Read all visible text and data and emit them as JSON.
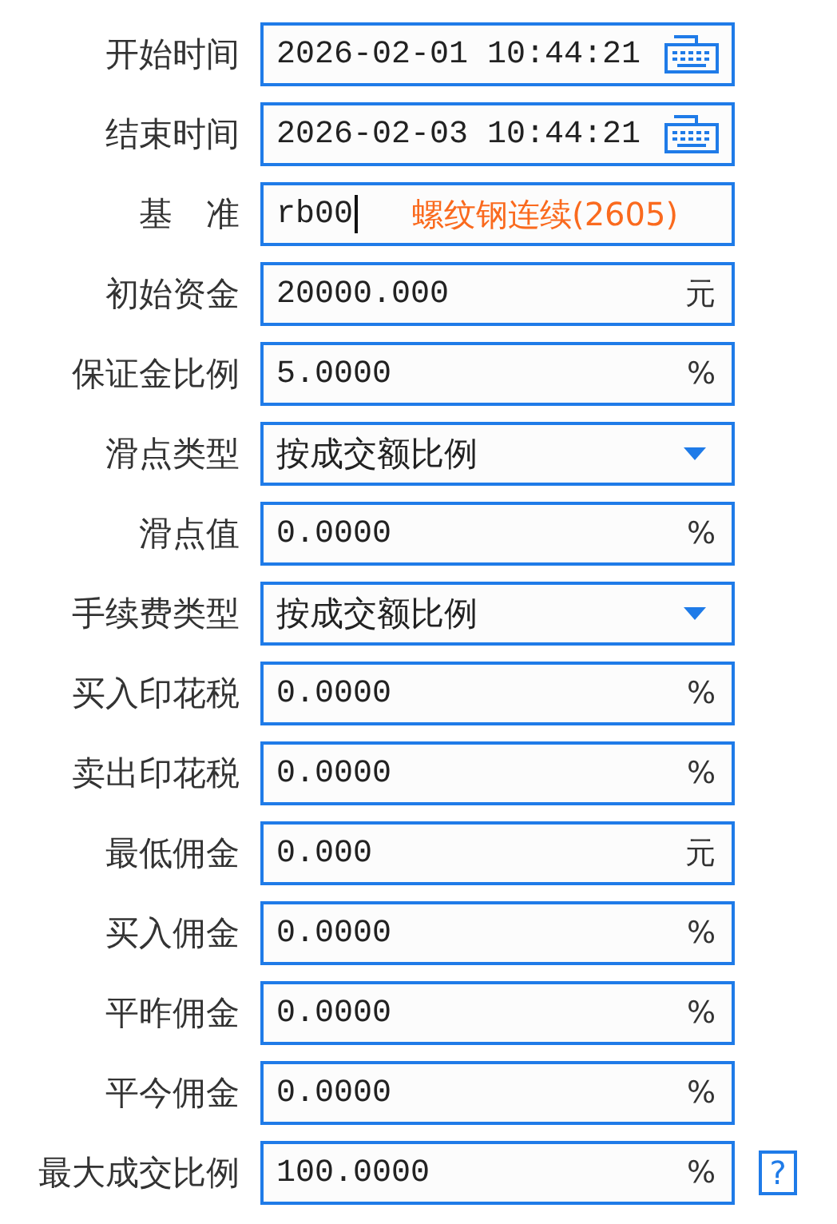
{
  "fields": [
    {
      "kind": "datetime",
      "label": "开始时间",
      "value": "2026-02-01 10:44:21"
    },
    {
      "kind": "datetime",
      "label": "结束时间",
      "value": "2026-02-03 10:44:21"
    },
    {
      "kind": "code",
      "label": "基　准",
      "value": "rb00",
      "focused": true,
      "note": "螺纹钢连续(2605)"
    },
    {
      "kind": "number",
      "label": "初始资金",
      "value": "20000.000",
      "unit": "元"
    },
    {
      "kind": "number",
      "label": "保证金比例",
      "value": "5.0000",
      "unit": "%"
    },
    {
      "kind": "select",
      "label": "滑点类型",
      "value": "按成交额比例"
    },
    {
      "kind": "number",
      "label": "滑点值",
      "value": "0.0000",
      "unit": "%"
    },
    {
      "kind": "select",
      "label": "手续费类型",
      "value": "按成交额比例"
    },
    {
      "kind": "number",
      "label": "买入印花税",
      "value": "0.0000",
      "unit": "%"
    },
    {
      "kind": "number",
      "label": "卖出印花税",
      "value": "0.0000",
      "unit": "%"
    },
    {
      "kind": "number",
      "label": "最低佣金",
      "value": "0.000",
      "unit": "元"
    },
    {
      "kind": "number",
      "label": "买入佣金",
      "value": "0.0000",
      "unit": "%"
    },
    {
      "kind": "number",
      "label": "平昨佣金",
      "value": "0.0000",
      "unit": "%"
    },
    {
      "kind": "number",
      "label": "平今佣金",
      "value": "0.0000",
      "unit": "%"
    },
    {
      "kind": "number",
      "label": "最大成交比例",
      "value": "100.0000",
      "unit": "%",
      "help": "?"
    }
  ]
}
